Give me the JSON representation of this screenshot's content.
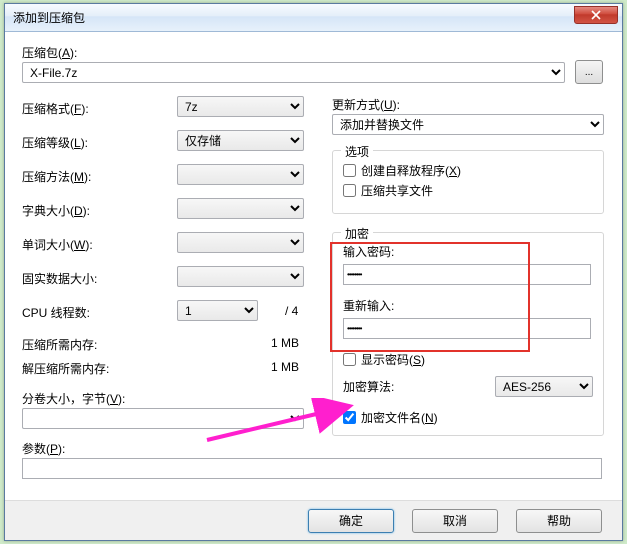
{
  "title": "添加到压缩包",
  "archive": {
    "label": "压缩包(",
    "hotkey": "A",
    "label2": "):",
    "value": "X-File.7z",
    "browse": "..."
  },
  "left": {
    "format": {
      "label": "压缩格式(",
      "hotkey": "F",
      "label2": "):",
      "value": "7z"
    },
    "level": {
      "label": "压缩等级(",
      "hotkey": "L",
      "label2": "):",
      "value": "仅存储"
    },
    "method": {
      "label": "压缩方法(",
      "hotkey": "M",
      "label2": "):",
      "value": ""
    },
    "dict": {
      "label": "字典大小(",
      "hotkey": "D",
      "label2": "):",
      "value": ""
    },
    "word": {
      "label": "单词大小(",
      "hotkey": "W",
      "label2": "):",
      "value": ""
    },
    "solid": {
      "label": "固实数据大小:",
      "value": ""
    },
    "cpu": {
      "label": "CPU 线程数:",
      "value": "1",
      "max": "/ 4"
    },
    "memc": {
      "label": "压缩所需内存:",
      "value": "1 MB"
    },
    "memd": {
      "label": "解压缩所需内存:",
      "value": "1 MB"
    },
    "split": {
      "label": "分卷大小，字节(",
      "hotkey": "V",
      "label2": "):"
    },
    "params": {
      "label": "参数(",
      "hotkey": "P",
      "label2": "):"
    }
  },
  "right": {
    "update": {
      "label": "更新方式(",
      "hotkey": "U",
      "label2": "):",
      "value": "添加并替换文件"
    },
    "options_title": "选项",
    "opt_sfx": {
      "label": "创建自释放程序(",
      "hotkey": "X",
      "label2": ")",
      "checked": false
    },
    "opt_share": {
      "label": "压缩共享文件",
      "checked": false
    },
    "enc_title": "加密",
    "pwd1_label": "输入密码:",
    "pwd1_value": "••••••••",
    "pwd2_label": "重新输入:",
    "pwd2_value": "••••••••",
    "show_pwd": {
      "label": "显示密码(",
      "hotkey": "S",
      "label2": ")",
      "checked": false
    },
    "enc_method": {
      "label": "加密算法:",
      "value": "AES-256"
    },
    "enc_names": {
      "label": "加密文件名(",
      "hotkey": "N",
      "label2": ")",
      "checked": true
    }
  },
  "buttons": {
    "ok": "确定",
    "cancel": "取消",
    "help": "帮助"
  }
}
